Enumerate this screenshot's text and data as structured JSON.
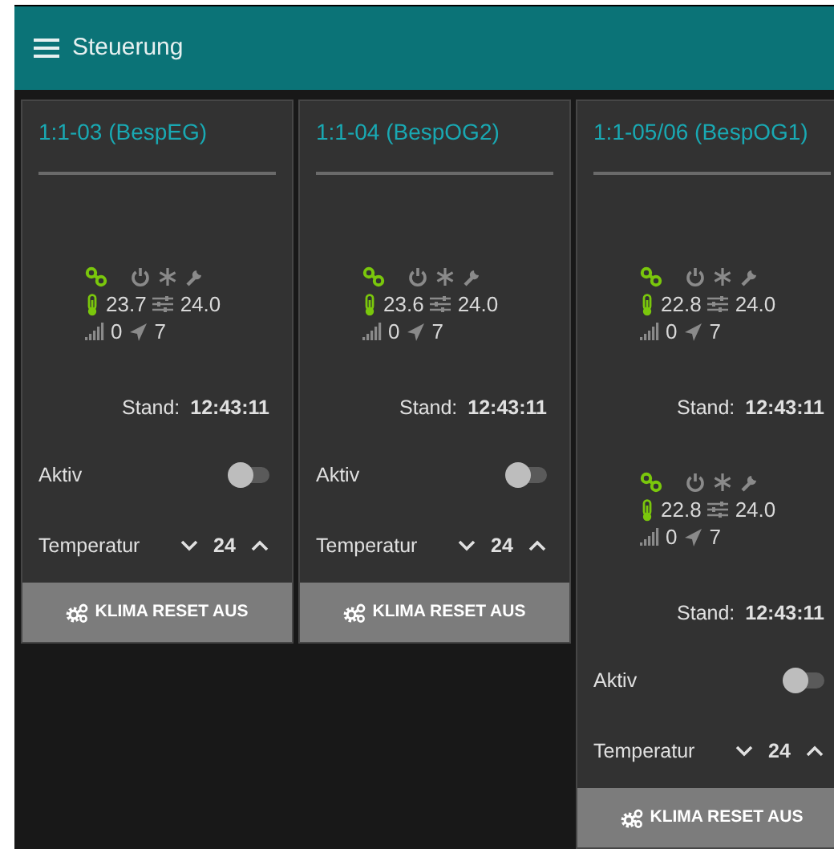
{
  "header": {
    "title": "Steuerung"
  },
  "cards": [
    {
      "title": "1:1-03 (BespEG)",
      "devices": [
        {
          "online": true,
          "power": false,
          "cooling": false,
          "fault": false,
          "temperature": "23.7",
          "setpoint": "24.0",
          "signal": "0",
          "wind": "7",
          "stand_label": "Stand:",
          "time": "12:43:11"
        }
      ],
      "active_label": "Aktiv",
      "active": false,
      "temp_label": "Temperatur",
      "temp_value": "24",
      "button": "KLIMA RESET AUS"
    },
    {
      "title": "1:1-04 (BespOG2)",
      "devices": [
        {
          "online": true,
          "power": false,
          "cooling": false,
          "fault": false,
          "temperature": "23.6",
          "setpoint": "24.0",
          "signal": "0",
          "wind": "7",
          "stand_label": "Stand:",
          "time": "12:43:11"
        }
      ],
      "active_label": "Aktiv",
      "active": false,
      "temp_label": "Temperatur",
      "temp_value": "24",
      "button": "KLIMA RESET AUS"
    },
    {
      "title": "1:1-05/06 (BespOG1)",
      "devices": [
        {
          "online": true,
          "power": false,
          "cooling": false,
          "fault": false,
          "temperature": "22.8",
          "setpoint": "24.0",
          "signal": "0",
          "wind": "7",
          "stand_label": "Stand:",
          "time": "12:43:11"
        },
        {
          "online": true,
          "power": false,
          "cooling": false,
          "fault": false,
          "temperature": "22.8",
          "setpoint": "24.0",
          "signal": "0",
          "wind": "7",
          "stand_label": "Stand:",
          "time": "12:43:11"
        }
      ],
      "active_label": "Aktiv",
      "active": false,
      "temp_label": "Temperatur",
      "temp_value": "24",
      "button": "KLIMA RESET AUS"
    }
  ]
}
